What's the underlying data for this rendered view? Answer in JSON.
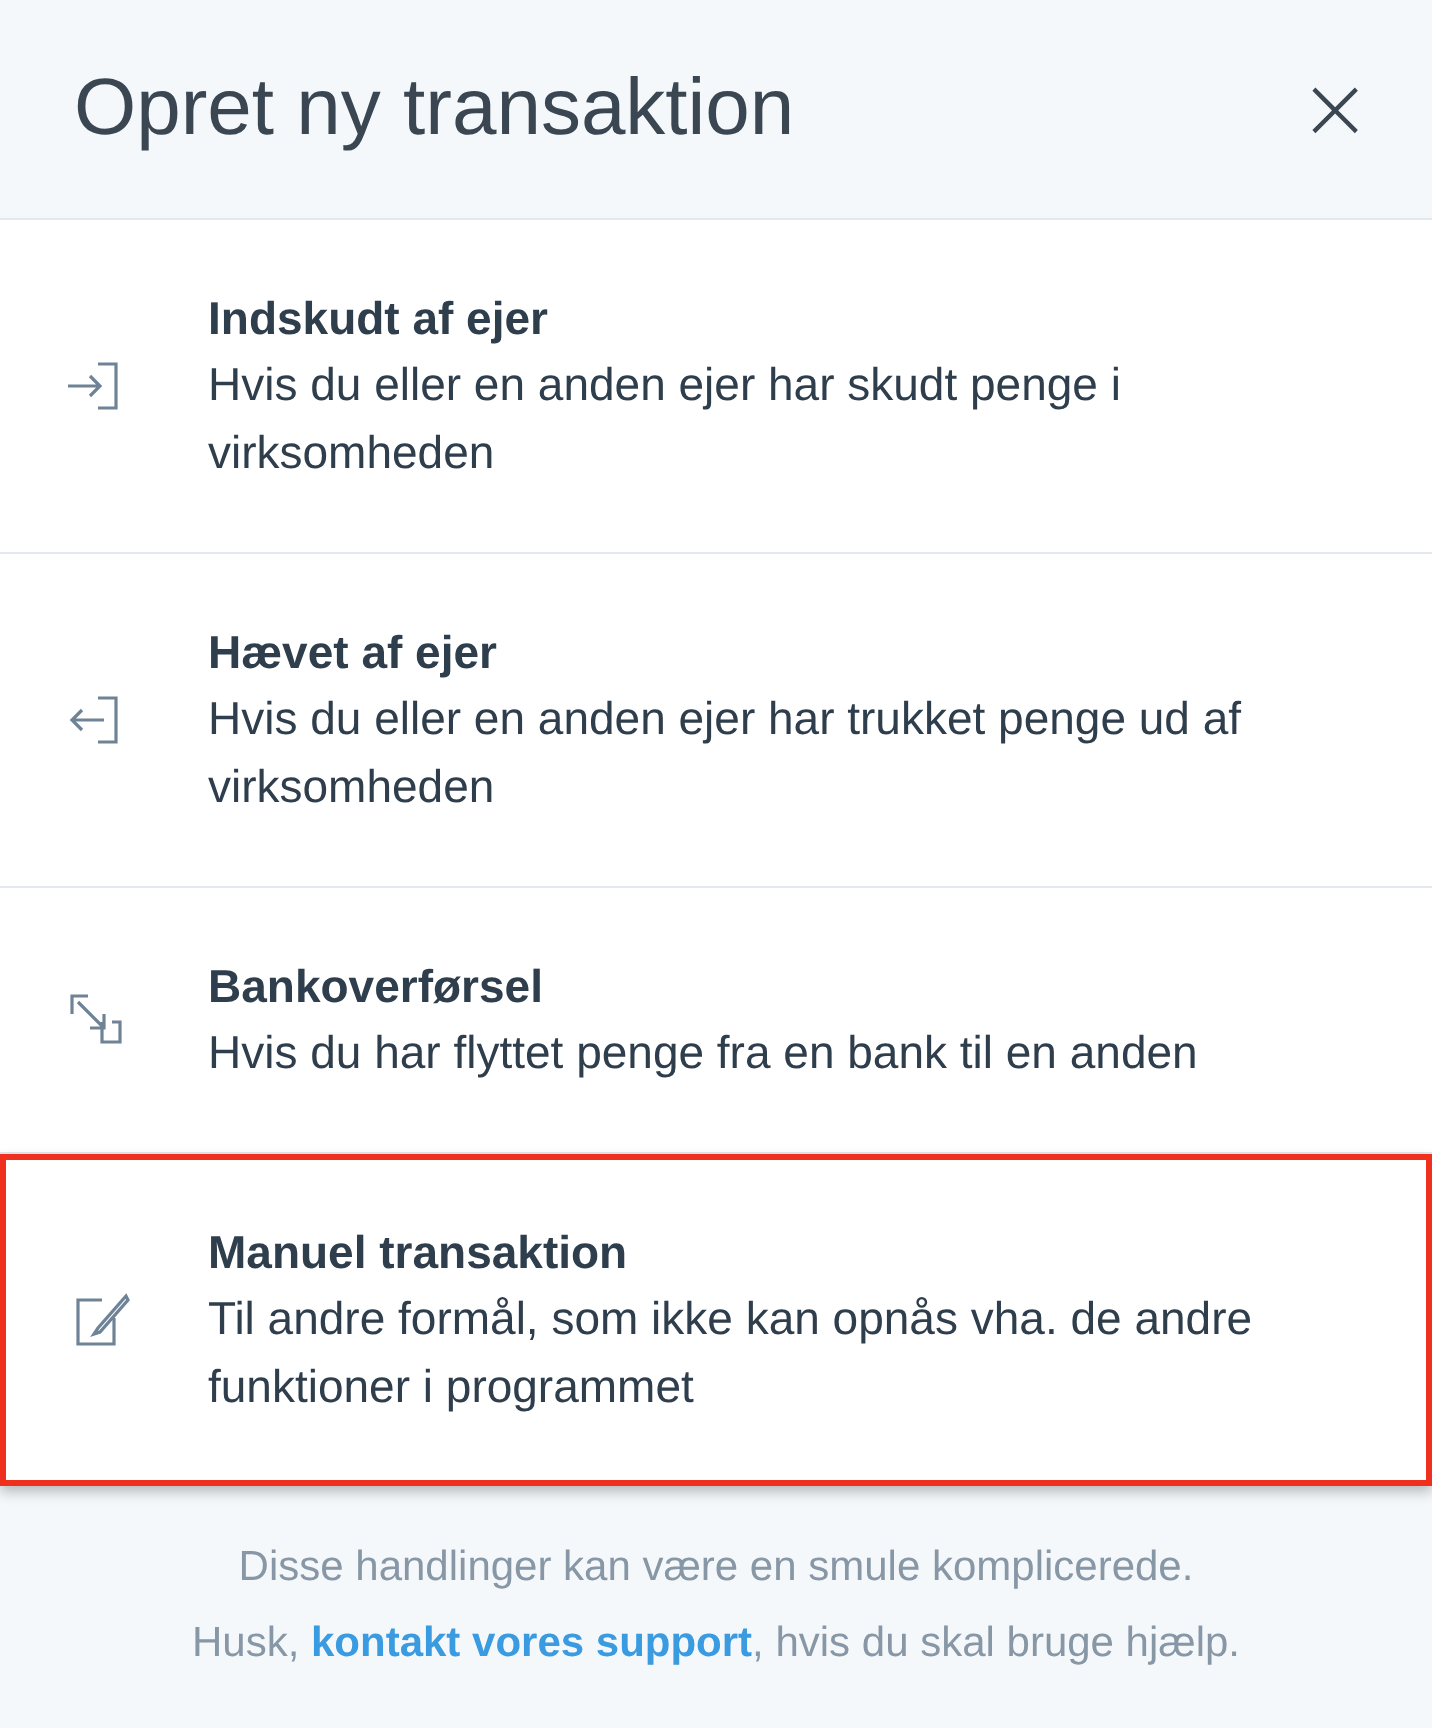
{
  "dialog": {
    "title": "Opret ny transaktion",
    "close_label": "×"
  },
  "options": [
    {
      "kind": "deposit",
      "title": "Indskudt af ejer",
      "description": "Hvis du eller en anden ejer har skudt penge i virksomheden",
      "selected": false
    },
    {
      "kind": "withdrawal",
      "title": "Hævet af ejer",
      "description": "Hvis du eller en anden ejer har trukket penge ud af virksomheden",
      "selected": false
    },
    {
      "kind": "transfer",
      "title": "Bankoverførsel",
      "description": "Hvis du har flyttet penge fra en bank til en anden",
      "selected": false
    },
    {
      "kind": "manual",
      "title": "Manuel transaktion",
      "description": "Til andre formål, som ikke kan opnås vha. de andre funktioner i programmet",
      "selected": true
    }
  ],
  "footer": {
    "line_1": "Disse handlinger kan være en smule komplicerede.",
    "line_2_before": "Husk, ",
    "link": "kontakt vores support",
    "line_2_after": ", hvis du skal bruge hjælp."
  }
}
